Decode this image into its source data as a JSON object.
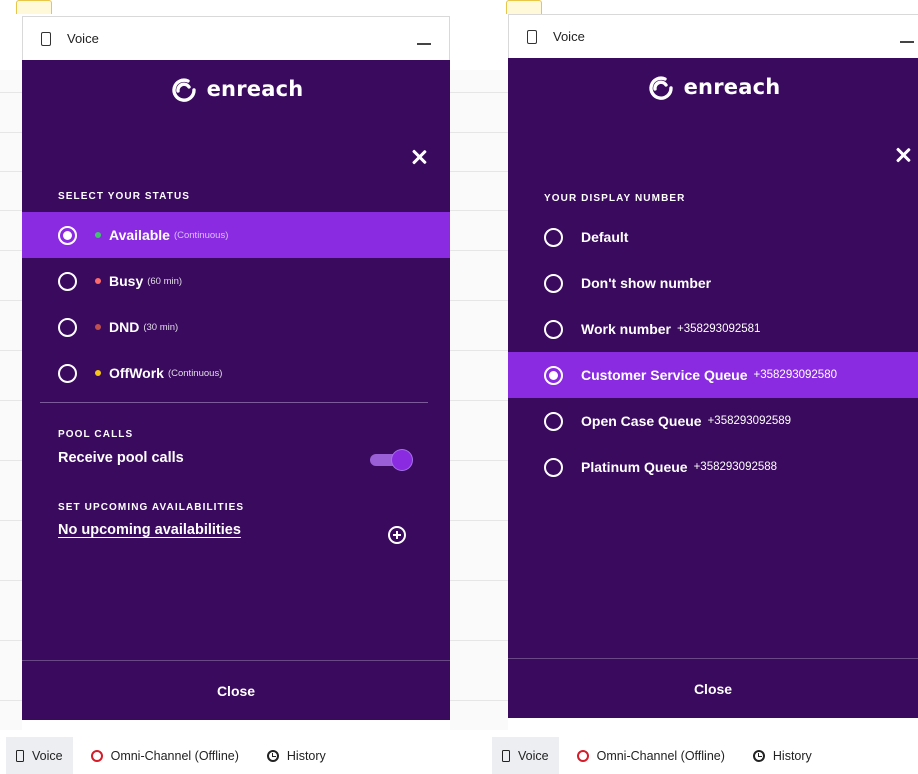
{
  "colors": {
    "panel_bg": "#3a0a5e",
    "highlight": "#8a2be2",
    "available": "#3fc56b",
    "busy": "#ff6b6b",
    "dnd": "#c0504d",
    "offwork": "#f5c518",
    "offline": "#d61b2a"
  },
  "left_panel": {
    "window_title": "Voice",
    "brand": "enreach",
    "status_section_label": "SELECT YOUR STATUS",
    "statuses": [
      {
        "name": "Available",
        "sub": "(Continuous)",
        "selected": true,
        "dot_color": "#3fc56b"
      },
      {
        "name": "Busy",
        "sub": "(60 min)",
        "selected": false,
        "dot_color": "#ff6b6b"
      },
      {
        "name": "DND",
        "sub": "(30 min)",
        "selected": false,
        "dot_color": "#c0504d"
      },
      {
        "name": "OffWork",
        "sub": "(Continuous)",
        "selected": false,
        "dot_color": "#f5c518"
      }
    ],
    "pool_section_label": "POOL CALLS",
    "pool_toggle_label": "Receive pool calls",
    "pool_toggle_on": true,
    "upcoming_section_label": "SET UPCOMING AVAILABILITIES",
    "upcoming_link": "No upcoming availabilities",
    "close_label": "Close"
  },
  "right_panel": {
    "window_title": "Voice",
    "brand": "enreach",
    "display_section_label": "YOUR DISPLAY NUMBER",
    "numbers": [
      {
        "name": "Default",
        "number": "",
        "selected": false
      },
      {
        "name": "Don't show number",
        "number": "",
        "selected": false
      },
      {
        "name": "Work number",
        "number": "+358293092581",
        "selected": false
      },
      {
        "name": "Customer Service Queue",
        "number": "+358293092580",
        "selected": true
      },
      {
        "name": "Open Case Queue",
        "number": "+358293092589",
        "selected": false
      },
      {
        "name": "Platinum Queue",
        "number": "+358293092588",
        "selected": false
      }
    ],
    "close_label": "Close"
  },
  "utility_bar_left": {
    "voice": "Voice",
    "omni": "Omni-Channel (Offline)",
    "history": "History"
  },
  "utility_bar_right": {
    "voice": "Voice",
    "omni": "Omni-Channel (Offline)",
    "history": "History"
  }
}
